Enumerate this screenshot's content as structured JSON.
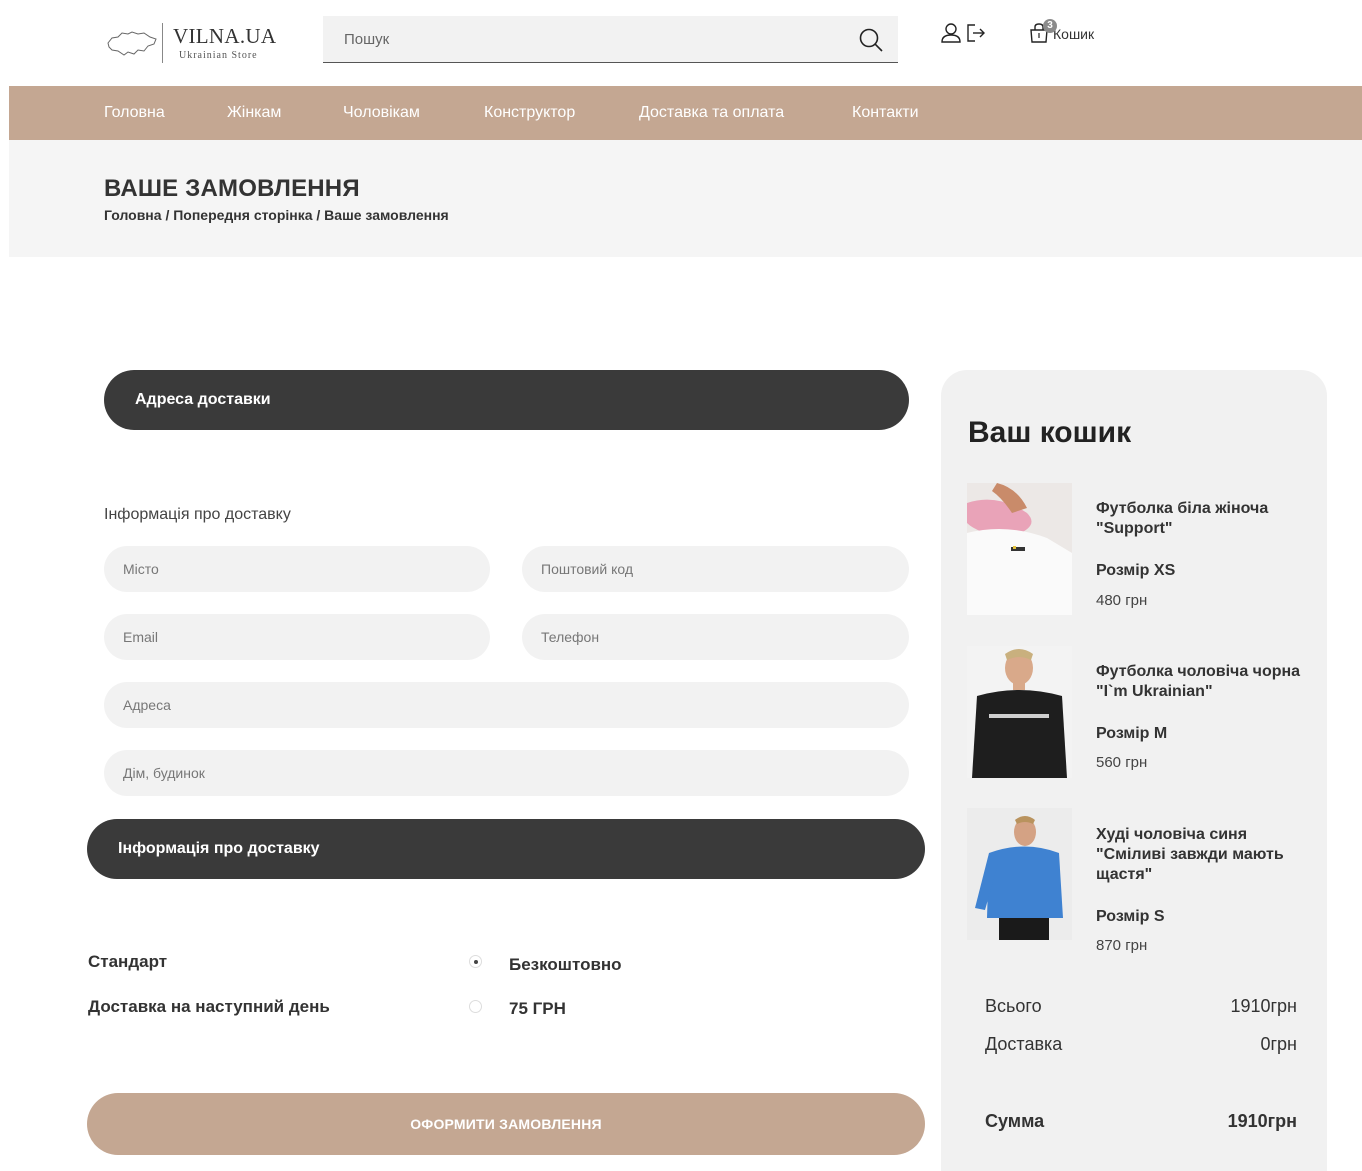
{
  "header": {
    "logo_title": "VILNA.UA",
    "logo_subtitle": "Ukrainian Store",
    "search_placeholder": "Пошук",
    "cart_label": "Кошик",
    "cart_count": "3"
  },
  "nav": {
    "items": [
      "Головна",
      "Жінкам",
      "Чоловікам",
      "Конструктор",
      "Доставка та оплата",
      "Контакти"
    ]
  },
  "banner": {
    "title": "ВАШЕ ЗАМОВЛЕННЯ",
    "breadcrumb": "Головна / Попередня сторінка / Ваше замовлення"
  },
  "form": {
    "address_header": "Адреса доставки",
    "section_label": "Інформація про доставку",
    "city_placeholder": "Місто",
    "postcode_placeholder": "Поштовий код",
    "email_placeholder": "Email",
    "phone_placeholder": "Телефон",
    "address_placeholder": "Адреса",
    "house_placeholder": "Дім, будинок",
    "delivery_header": "Інформація про доставку"
  },
  "shipping": {
    "options": [
      {
        "label": "Стандарт",
        "price": "Безкоштовно",
        "selected": true
      },
      {
        "label": "Доставка на наступний день",
        "price": "75 ГРН",
        "selected": false
      }
    ]
  },
  "order_button": "ОФОРМИТИ ЗАМОВЛЕННЯ",
  "cart": {
    "title": "Ваш кошик",
    "items": [
      {
        "name": "Футболка біла жіноча \"Support\"",
        "size": "Розмір XS",
        "price": "480 грн"
      },
      {
        "name": "Футболка чоловіча чорна \"I`m Ukrainian\"",
        "size": "Розмір M",
        "price": "560 грн"
      },
      {
        "name": "Худі чоловіча синя \"Сміливі завжди мають щастя\"",
        "size": "Розмір S",
        "price": "870 грн"
      }
    ],
    "total_label": "Всього",
    "total_value": "1910грн",
    "delivery_label": "Доставка",
    "delivery_value": "0грн",
    "sum_label": "Сумма",
    "sum_value": "1910грн"
  },
  "colors": {
    "accent": "#c4a792",
    "dark": "#3a3a3a",
    "field_bg": "#f2f2f2"
  }
}
